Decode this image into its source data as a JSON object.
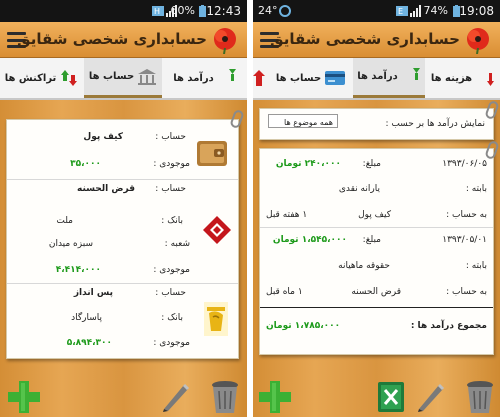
{
  "left_status": {
    "battery": "60%",
    "time": "12:43"
  },
  "right_status": {
    "temp": "24°",
    "battery": "74%",
    "time": "19:08"
  },
  "app": {
    "title": "حسابداری شخصی شقایق"
  },
  "left_tabs": [
    {
      "label": "تراکنش ها"
    },
    {
      "label": "حساب ها"
    },
    {
      "label": "درآمد ها"
    }
  ],
  "right_tabs": [
    {
      "label": "حساب ها"
    },
    {
      "label": "درآمد ها"
    },
    {
      "label": "هزینه ها"
    }
  ],
  "accounts": [
    {
      "account_label": "حساب :",
      "name": "کیف پول",
      "balance_label": "موجودی :",
      "balance": "۳۵،۰۰۰"
    },
    {
      "account_label": "حساب :",
      "name": "قرض الحسنه",
      "bank_label": "بانک :",
      "bank": "ملت",
      "branch_label": "شعبه :",
      "branch": "سبزه میدان",
      "balance_label": "موجودی :",
      "balance": "۴،۴۱۴،۰۰۰"
    },
    {
      "account_label": "حساب :",
      "name": "پس انداز",
      "bank_label": "بانک :",
      "bank": "پاسارگاد",
      "balance_label": "موجودی :",
      "balance": "۵،۸۹۴،۳۰۰"
    }
  ],
  "income": {
    "filter_label": "نمایش درآمد ها بر حسب :",
    "filter_value": "همه موضوع ها",
    "entries": [
      {
        "date": "۱۳۹۳/۰۶/۰۵",
        "amount_label": "مبلغ:",
        "amount": "۲۴۰،۰۰۰ تومان",
        "subject_label": "بابته :",
        "subject": "یارانه نقدی",
        "to_account_label": "به حساب :",
        "to_account": "کیف پول",
        "ago": "۱ هفته قبل"
      },
      {
        "date": "۱۳۹۳/۰۵/۰۱",
        "amount_label": "مبلغ:",
        "amount": "۱،۵۴۵،۰۰۰ تومان",
        "subject_label": "بابته :",
        "subject": "حقوقه ماهیانه",
        "to_account_label": "به حساب :",
        "to_account": "قرض الحسنه",
        "ago": "۱ ماه قبل"
      }
    ],
    "total_label": "مجموع درآمد ها :",
    "total": "۱،۷۸۵،۰۰۰ تومان"
  },
  "colors": {
    "green": "#1d9a1a",
    "wood": "#d99540",
    "melat": "#c4161c",
    "pasargad": "#e8b415"
  }
}
